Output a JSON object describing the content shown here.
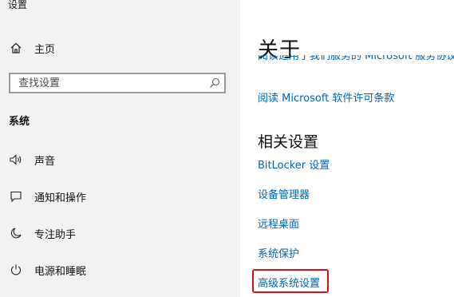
{
  "app": {
    "title": "设置"
  },
  "sidebar": {
    "home_label": "主页",
    "search": {
      "placeholder": "查找设置"
    },
    "section_label": "系统",
    "items": [
      {
        "label": "声音",
        "icon": "speaker-icon"
      },
      {
        "label": "通知和操作",
        "icon": "notification-icon"
      },
      {
        "label": "专注助手",
        "icon": "moon-icon"
      },
      {
        "label": "电源和睡眠",
        "icon": "power-icon"
      }
    ]
  },
  "main": {
    "title": "关于",
    "partial_link": "阅读适用于我们服务的 Microsoft 服务协议",
    "license_link": "阅读 Microsoft 软件许可条款",
    "related_heading": "相关设置",
    "related_links": [
      "BitLocker 设置",
      "设备管理器",
      "远程桌面",
      "系统保护",
      "高级系统设置"
    ]
  },
  "colors": {
    "link": "#0063b1",
    "highlight": "#e01010",
    "sidebar_bg": "#f2f2f2"
  }
}
